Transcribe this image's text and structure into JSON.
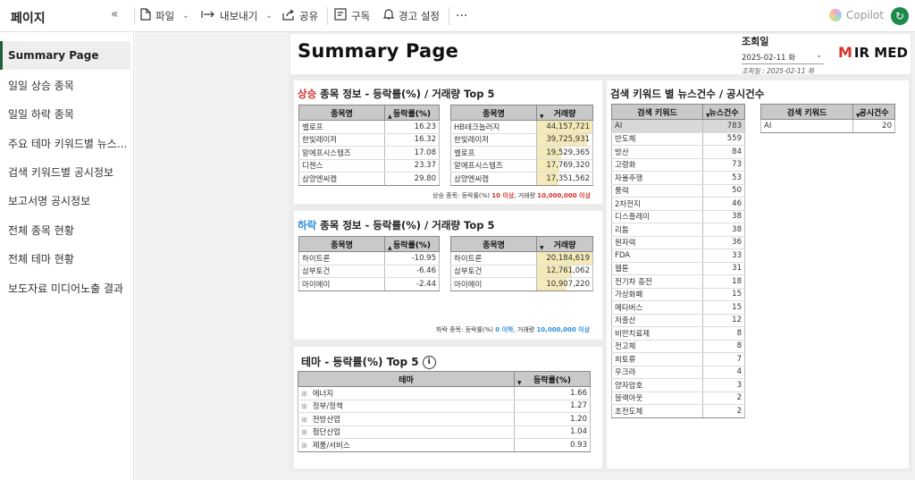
{
  "pane": {
    "title": "페이지",
    "collapse_glyph": "«"
  },
  "toolbar": {
    "file": "파일",
    "export": "내보내기",
    "share": "공유",
    "subscribe": "구독",
    "alert": "경고 설정",
    "more": "···",
    "copilot": "Copilot"
  },
  "nav": [
    {
      "label": "Summary Page",
      "active": true
    },
    {
      "label": "일일 상승 종목"
    },
    {
      "label": "일일 하락 종목"
    },
    {
      "label": "주요 테마 키워드별 뉴스..."
    },
    {
      "label": "검색 키워드별 공시정보"
    },
    {
      "label": "보고서명 공시정보"
    },
    {
      "label": "전체 종목 현황"
    },
    {
      "label": "전체 테마 현황"
    },
    {
      "label": "보도자료 미디어노출 결과"
    }
  ],
  "header": {
    "title": "Summary Page",
    "date_label": "조회일",
    "date_value": "2025-02-11 화",
    "date_note": "조회일 : 2025-02-11 화",
    "brand": "IR MED",
    "brand_mark": "M"
  },
  "rise": {
    "title_prefix": "상승",
    "title_rest": " 종목 정보 - 등락률(%) / 거래량 Top 5",
    "rate_table": {
      "headers": [
        "종목명",
        "등락률(%)"
      ],
      "rows": [
        [
          "벨로프",
          "16.23"
        ],
        [
          "한빛레이저",
          "16.32"
        ],
        [
          "알에프시스템즈",
          "17.08"
        ],
        [
          "디젠스",
          "23.37"
        ],
        [
          "삼양엔씨켐",
          "29.80"
        ]
      ]
    },
    "volume_table": {
      "headers": [
        "종목명",
        "거래량"
      ],
      "rows": [
        [
          "HB테크놀러지",
          "44,157,721"
        ],
        [
          "한빛레이저",
          "39,725,931"
        ],
        [
          "벨로프",
          "19,529,365"
        ],
        [
          "알에프시스템즈",
          "17,769,320"
        ],
        [
          "삼양엔씨켐",
          "17,351,562"
        ]
      ],
      "fill_fraction": [
        1.0,
        0.9,
        0.44,
        0.4,
        0.39
      ]
    },
    "note_a": "상승 종목: 등락률(%) ",
    "note_b": "10 이상",
    "note_c": ", 거래량 ",
    "note_d": "10,000,000 이상"
  },
  "fall": {
    "title_prefix": "하락",
    "title_rest": " 종목 정보 - 등락률(%) / 거래량 Top 5",
    "rate_table": {
      "headers": [
        "종목명",
        "등락률(%)"
      ],
      "rows": [
        [
          "하이트론",
          "-10.95"
        ],
        [
          "삼부토건",
          "-6.46"
        ],
        [
          "아이에이",
          "-2.44"
        ]
      ]
    },
    "volume_table": {
      "headers": [
        "종목명",
        "거래량"
      ],
      "rows": [
        [
          "하이트론",
          "20,184,619"
        ],
        [
          "삼부토건",
          "12,761,062"
        ],
        [
          "아이에이",
          "10,907,220"
        ]
      ],
      "fill_fraction": [
        1.0,
        0.63,
        0.54
      ]
    },
    "note_a": "하락 종목: 등락률(%) ",
    "note_b": "0 이하",
    "note_c": ", 거래량 ",
    "note_d": "10,000,000 이상"
  },
  "theme": {
    "title": "테마 - 등락률(%)  Top 5",
    "headers": [
      "테마",
      "등락률(%)"
    ],
    "rows": [
      [
        "에너지",
        "1.66"
      ],
      [
        "정부/정책",
        "1.27"
      ],
      [
        "전방산업",
        "1.20"
      ],
      [
        "첨단산업",
        "1.04"
      ],
      [
        "제품/서비스",
        "0.93"
      ]
    ]
  },
  "keywords": {
    "title": "검색 키워드 별 뉴스건수 / 공시건수",
    "news_table": {
      "headers": [
        "검색 키워드",
        "뉴스건수"
      ],
      "rows": [
        [
          "AI",
          "783"
        ],
        [
          "반도체",
          "559"
        ],
        [
          "방산",
          "84"
        ],
        [
          "고령화",
          "73"
        ],
        [
          "자율주행",
          "53"
        ],
        [
          "풍력",
          "50"
        ],
        [
          "2차전지",
          "46"
        ],
        [
          "디스플레이",
          "38"
        ],
        [
          "리튬",
          "38"
        ],
        [
          "원자력",
          "36"
        ],
        [
          "FDA",
          "33"
        ],
        [
          "웹툰",
          "31"
        ],
        [
          "전기차 충전",
          "18"
        ],
        [
          "가상화폐",
          "15"
        ],
        [
          "메타버스",
          "15"
        ],
        [
          "저출산",
          "12"
        ],
        [
          "비만치료제",
          "8"
        ],
        [
          "전고체",
          "8"
        ],
        [
          "희토류",
          "7"
        ],
        [
          "우크라",
          "4"
        ],
        [
          "양자암호",
          "3"
        ],
        [
          "블랙아웃",
          "2"
        ],
        [
          "초전도체",
          "2"
        ]
      ]
    },
    "disclosure_table": {
      "headers": [
        "검색 키워드",
        "공시건수"
      ],
      "rows": [
        [
          "AI",
          "20"
        ]
      ]
    }
  }
}
